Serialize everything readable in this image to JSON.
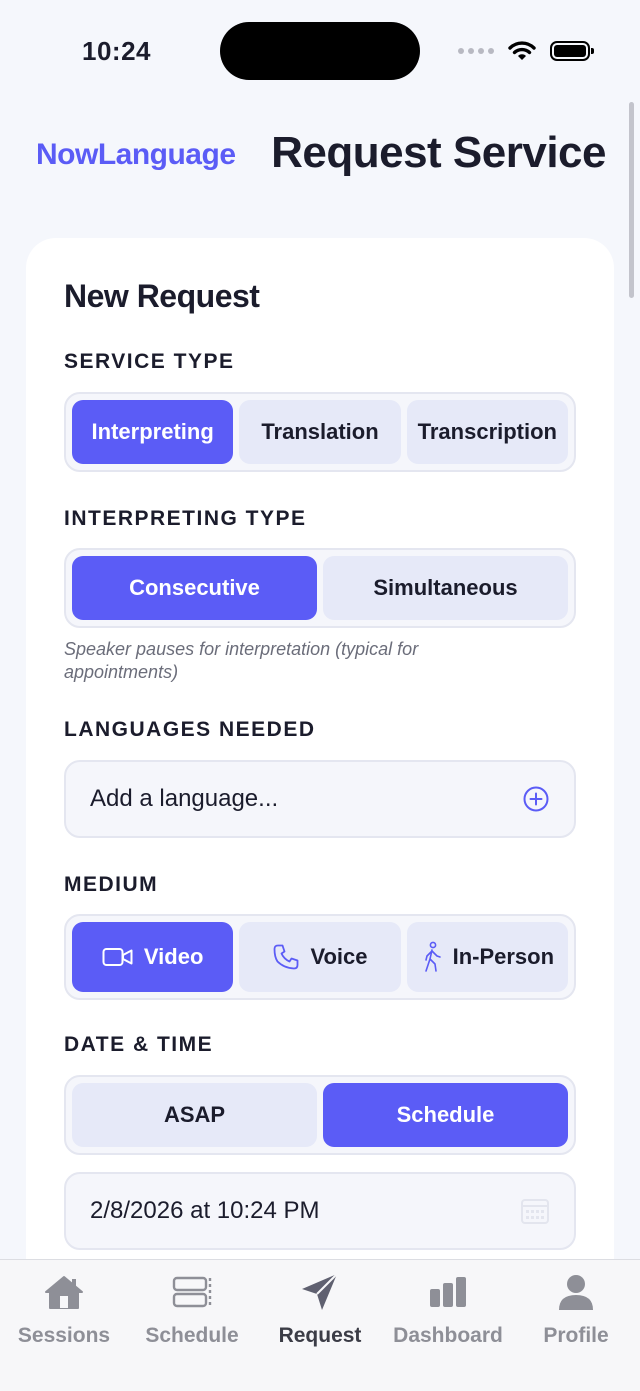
{
  "status_bar": {
    "time": "10:24"
  },
  "header": {
    "brand": "NowLanguage",
    "title": "Request Service"
  },
  "form": {
    "title": "New Request",
    "service_type": {
      "label": "SERVICE TYPE",
      "options": [
        "Interpreting",
        "Translation",
        "Transcription"
      ],
      "selected": "Interpreting"
    },
    "interpreting_type": {
      "label": "INTERPRETING TYPE",
      "options": [
        "Consecutive",
        "Simultaneous"
      ],
      "selected": "Consecutive",
      "helper": "Speaker pauses for interpretation (typical for appointments)"
    },
    "languages": {
      "label": "LANGUAGES NEEDED",
      "placeholder": "Add a language..."
    },
    "medium": {
      "label": "MEDIUM",
      "options": [
        {
          "label": "Video",
          "icon": "video-camera-icon"
        },
        {
          "label": "Voice",
          "icon": "phone-icon"
        },
        {
          "label": "In-Person",
          "icon": "walking-person-icon"
        }
      ],
      "selected": "Video"
    },
    "date_time": {
      "label": "DATE & TIME",
      "options": [
        "ASAP",
        "Schedule"
      ],
      "selected": "Schedule",
      "value": "2/8/2026 at 10:24 PM"
    }
  },
  "tab_bar": {
    "items": [
      {
        "label": "Sessions",
        "icon": "house-icon"
      },
      {
        "label": "Schedule",
        "icon": "schedule-icon"
      },
      {
        "label": "Request",
        "icon": "paper-plane-icon"
      },
      {
        "label": "Dashboard",
        "icon": "bar-chart-icon"
      },
      {
        "label": "Profile",
        "icon": "person-icon"
      }
    ],
    "active": "Request"
  },
  "colors": {
    "accent": "#5b5cf6",
    "segment_inactive": "#e6e9f8",
    "background": "#f5f7fc",
    "tab_inactive": "#8e8f97"
  }
}
